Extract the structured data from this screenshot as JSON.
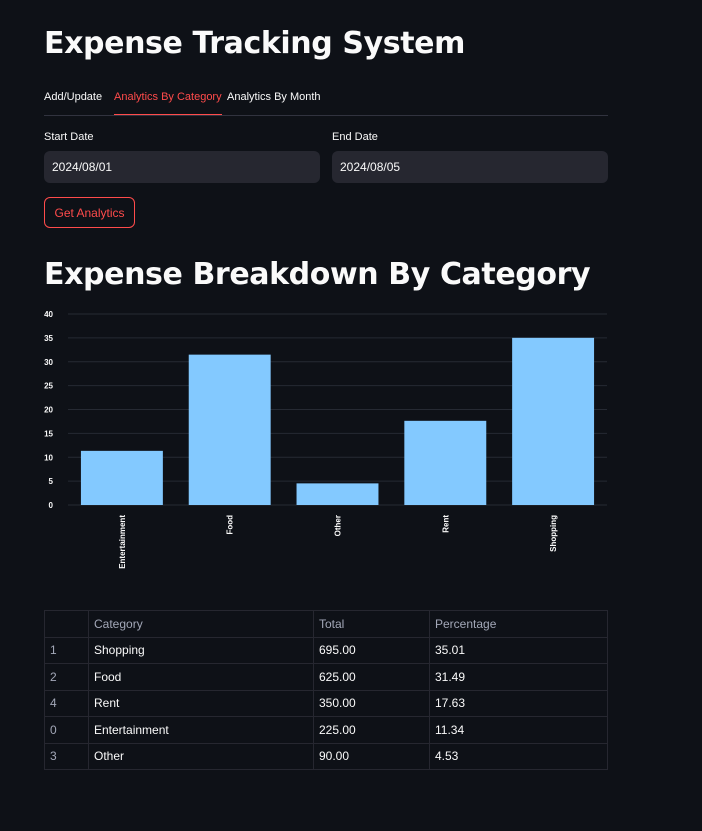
{
  "app": {
    "title": "Expense Tracking System"
  },
  "tabs": [
    {
      "label": "Add/Update",
      "active": false
    },
    {
      "label": "Analytics By Category",
      "active": true
    },
    {
      "label": "Analytics By Month",
      "active": false
    }
  ],
  "form": {
    "start_label": "Start Date",
    "start_value": "2024/08/01",
    "end_label": "End Date",
    "end_value": "2024/08/05",
    "button_label": "Get Analytics"
  },
  "section": {
    "title": "Expense Breakdown By Category"
  },
  "chart_data": {
    "type": "bar",
    "categories": [
      "Entertainment",
      "Food",
      "Other",
      "Rent",
      "Shopping"
    ],
    "values": [
      11.34,
      31.49,
      4.53,
      17.63,
      35.01
    ],
    "ylim": [
      0,
      40
    ],
    "yticks": [
      0,
      5,
      10,
      15,
      20,
      25,
      30,
      35,
      40
    ],
    "grid": true,
    "bar_color": "#83c9ff"
  },
  "table": {
    "columns": [
      "",
      "Category",
      "Total",
      "Percentage"
    ],
    "rows": [
      [
        "1",
        "Shopping",
        "695.00",
        "35.01"
      ],
      [
        "2",
        "Food",
        "625.00",
        "31.49"
      ],
      [
        "4",
        "Rent",
        "350.00",
        "17.63"
      ],
      [
        "0",
        "Entertainment",
        "225.00",
        "11.34"
      ],
      [
        "3",
        "Other",
        "90.00",
        "4.53"
      ]
    ]
  },
  "colors": {
    "background": "#0e1117",
    "accent": "#ff4b4b",
    "input_bg": "#262730"
  }
}
